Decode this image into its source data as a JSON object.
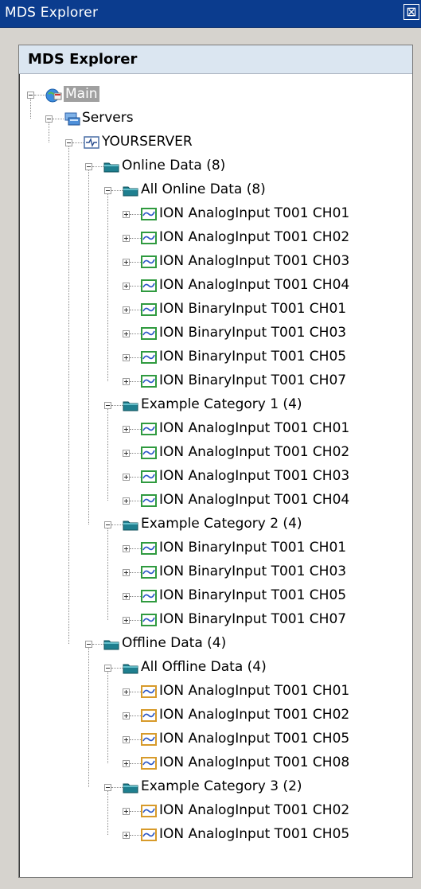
{
  "window": {
    "title": "MDS Explorer",
    "close_glyph": "⊠"
  },
  "pane": {
    "header": "MDS Explorer"
  },
  "tree": {
    "root": "Main",
    "servers": "Servers",
    "server": "YOURSERVER",
    "online_data": "Online Data (8)",
    "all_online": "All Online Data (8)",
    "all_online_items": [
      "ION AnalogInput T001 CH01",
      "ION AnalogInput T001 CH02",
      "ION AnalogInput T001 CH03",
      "ION AnalogInput T001 CH04",
      "ION BinaryInput T001 CH01",
      "ION BinaryInput T001 CH03",
      "ION BinaryInput T001 CH05",
      "ION BinaryInput T001 CH07"
    ],
    "cat1": "Example Category 1 (4)",
    "cat1_items": [
      "ION AnalogInput T001 CH01",
      "ION AnalogInput T001 CH02",
      "ION AnalogInput T001 CH03",
      "ION AnalogInput T001 CH04"
    ],
    "cat2": "Example Category 2 (4)",
    "cat2_items": [
      "ION BinaryInput T001 CH01",
      "ION BinaryInput T001 CH03",
      "ION BinaryInput T001 CH05",
      "ION BinaryInput T001 CH07"
    ],
    "offline_data": "Offline Data (4)",
    "all_offline": "All Offline Data (4)",
    "all_offline_items": [
      "ION AnalogInput T001 CH01",
      "ION AnalogInput T001 CH02",
      "ION AnalogInput T001 CH05",
      "ION AnalogInput T001 CH08"
    ],
    "cat3": "Example Category 3 (2)",
    "cat3_items": [
      "ION AnalogInput T001 CH02",
      "ION AnalogInput T001 CH05"
    ]
  },
  "colors": {
    "titlebar": "#0b3c8e",
    "online_icon": "#2f9a3f",
    "offline_icon": "#d79a2a",
    "folder": "#1f7f8f"
  },
  "icons": {
    "root": "main-globe-icon",
    "servers": "servers-icon",
    "server": "server-signal-icon",
    "folder": "folder-icon",
    "online_item": "online-data-icon",
    "offline_item": "offline-data-icon"
  }
}
